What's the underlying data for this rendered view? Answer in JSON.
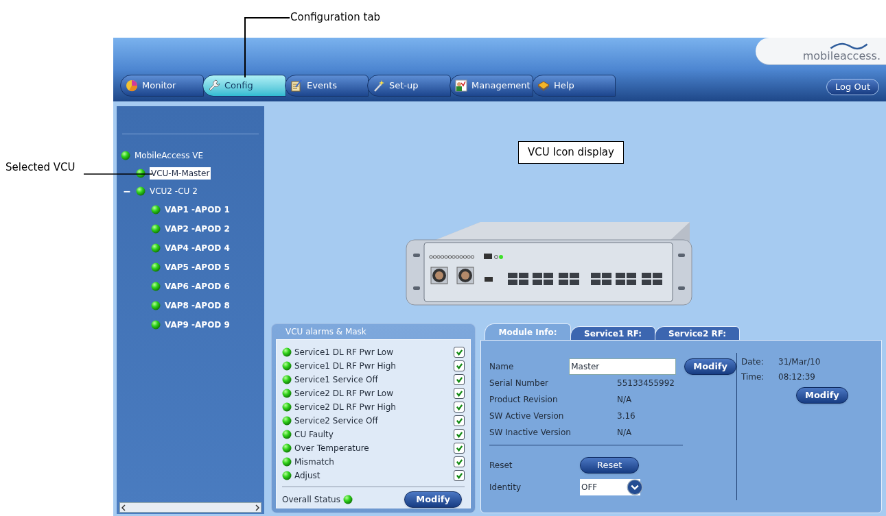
{
  "annotations": [
    {
      "kind": "tab",
      "text": "Configuration tab"
    },
    {
      "kind": "tree",
      "text": "Selected VCU"
    },
    {
      "kind": "device",
      "text": "VCU Icon display"
    }
  ],
  "header": {
    "logo": "mobileaccess.",
    "logout": "Log Out"
  },
  "tabs": [
    {
      "kind": "chart",
      "label": "Monitor",
      "selected": false
    },
    {
      "kind": "wrench",
      "label": "Config",
      "selected": true
    },
    {
      "kind": "notes",
      "label": "Events",
      "selected": false
    },
    {
      "kind": "wand",
      "label": "Set-up",
      "selected": false
    },
    {
      "kind": "person",
      "label": "Management",
      "selected": false
    },
    {
      "kind": "book",
      "label": "Help",
      "selected": false
    }
  ],
  "tree": [
    {
      "label": "MobileAccess VE",
      "selected": false,
      "children": [
        {
          "label": "VCU-M-Master",
          "selected": true
        },
        {
          "label": "VCU2 -CU 2",
          "selected": false,
          "expanded": true,
          "expander": "−",
          "children": [
            {
              "label": "VAP1 -APOD 1",
              "selected": false
            },
            {
              "label": "VAP2 -APOD 2",
              "selected": false
            },
            {
              "label": "VAP4 -APOD 4",
              "selected": false
            },
            {
              "label": "VAP5 -APOD 5",
              "selected": false
            },
            {
              "label": "VAP6 -APOD 6",
              "selected": false
            },
            {
              "label": "VAP8 -APOD 8",
              "selected": false
            },
            {
              "label": "VAP9 -APOD 9",
              "selected": false
            }
          ]
        }
      ]
    }
  ],
  "alarms": {
    "title": "VCU alarms & Mask",
    "items": [
      {
        "label": "Service1 DL RF Pwr Low",
        "checked": true
      },
      {
        "label": "Service1 DL RF Pwr High",
        "checked": true
      },
      {
        "label": "Service1 Service Off",
        "checked": true
      },
      {
        "label": "Service2 DL RF Pwr Low",
        "checked": true
      },
      {
        "label": "Service2 DL RF Pwr High",
        "checked": true
      },
      {
        "label": "Service2 Service Off",
        "checked": true
      },
      {
        "label": "CU Faulty",
        "checked": true
      },
      {
        "label": "Over Temperature",
        "checked": true
      },
      {
        "label": "Mismatch",
        "checked": true
      },
      {
        "label": "Adjust",
        "checked": true
      }
    ],
    "overall_label": "Overall Status",
    "modify": "Modify"
  },
  "module": {
    "tabs": [
      {
        "label": "Module Info:",
        "selected": true
      },
      {
        "label": "Service1 RF:",
        "selected": false
      },
      {
        "label": "Service2 RF:",
        "selected": false
      }
    ],
    "name_label": "Name",
    "name_value": "Master",
    "name_button": "Modify",
    "fields": [
      {
        "label": "Serial Number",
        "value": "55133455992"
      },
      {
        "label": "Product Revision",
        "value": "N/A"
      },
      {
        "label": "SW Active Version",
        "value": "3.16"
      },
      {
        "label": "SW Inactive Version",
        "value": "N/A"
      }
    ],
    "date_label": "Date:",
    "date": "31/Mar/10",
    "time_label": "Time:",
    "time": "08:12:39",
    "datetime_button": "Modify",
    "reset_label": "Reset",
    "reset_button": "Reset",
    "identity_label": "Identity",
    "identity_value": "OFF"
  }
}
